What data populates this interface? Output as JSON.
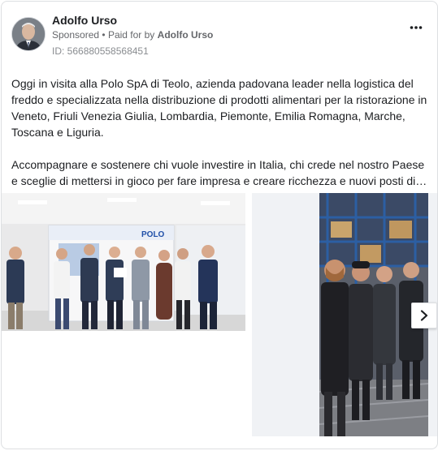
{
  "post": {
    "author": "Adolfo Urso",
    "sponsored": "Sponsored",
    "separator": "•",
    "paid_for_by": "Paid for by",
    "payer": "Adolfo Urso",
    "ad_id": "ID: 566880558568451",
    "more_icon": "more-horizontal-icon",
    "paragraph_1": "Oggi in visita alla Polo SpA di Teolo, azienda padovana leader nella logistica del freddo e specializzata nella distribuzione di prodotti alimentari per la ristorazione in Veneto, Friuli Venezia Giulia, Lombardia, Piemonte, Emilia Romagna, Marche, Toscana e Liguria.",
    "paragraph_2": "Accompagnare e sostenere chi vuole investire in Italia, chi crede nel nostro Paese e sceglie di mettersi in gioco per fare impresa e creare ricchezza e nuovi posti di…"
  },
  "carousel": {
    "slide_1": {
      "sign_text": "POLO"
    },
    "next_icon": "chevron-right-icon"
  },
  "colors": {
    "text": "#1c1e21",
    "secondary": "#65676b",
    "border": "#dddfe2",
    "carousel_bg": "#f0f2f5"
  }
}
